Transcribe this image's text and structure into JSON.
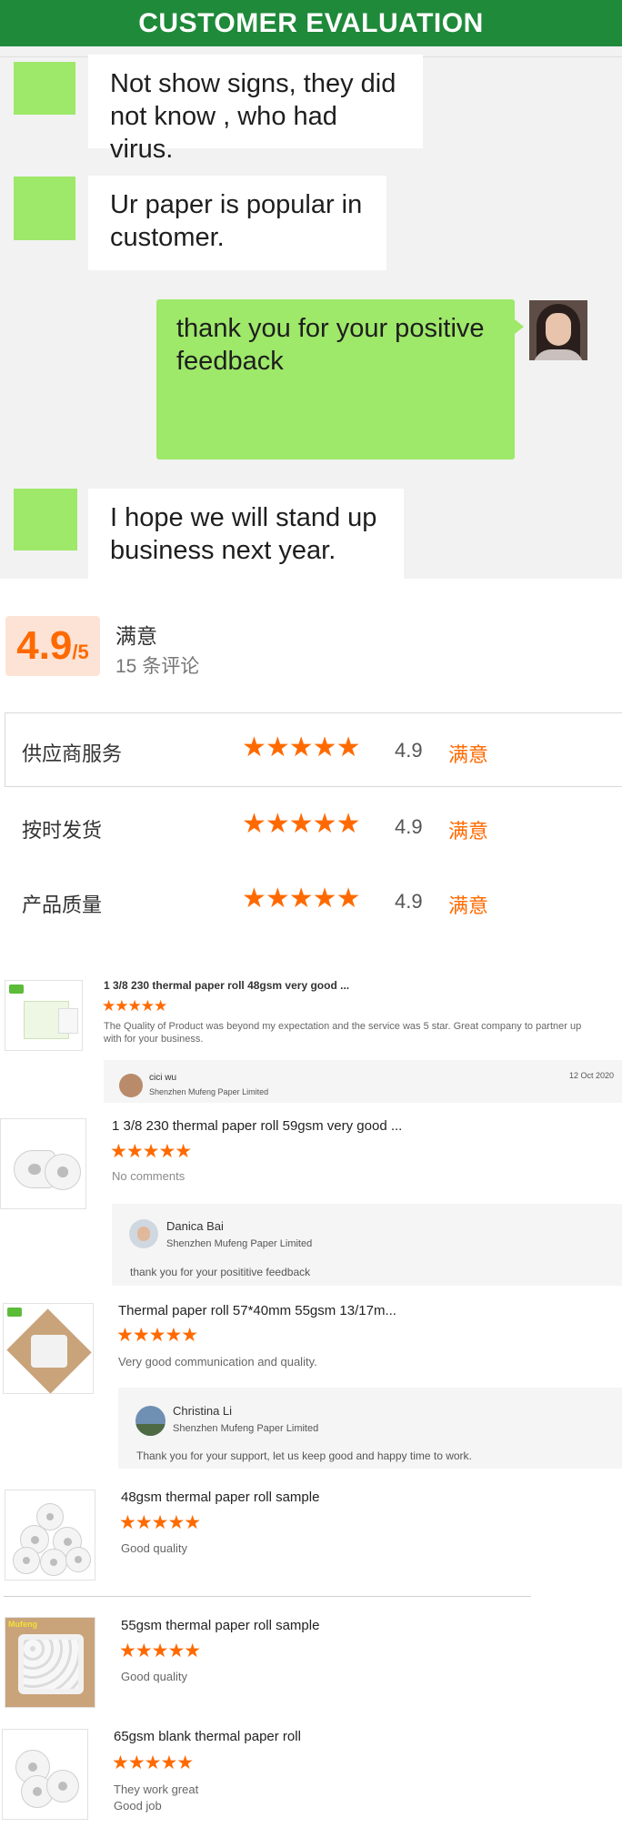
{
  "header": {
    "title": "CUSTOMER EVALUATION"
  },
  "chat": {
    "messages": [
      {
        "from": "customer",
        "text_lines": [
          "Not show signs, they did",
          "not know , who had virus."
        ]
      },
      {
        "from": "customer",
        "text_lines": [
          "Ur paper is popular in",
          "customer."
        ]
      },
      {
        "from": "seller",
        "text_lines": [
          "thank you for your positive",
          "feedback"
        ]
      },
      {
        "from": "customer",
        "text_lines": [
          "I hope we will stand up",
          "business next year."
        ]
      }
    ]
  },
  "rating_summary": {
    "score": "4.9",
    "score_suffix": "/5",
    "label": "满意",
    "count_text": "15 条评论",
    "stars_symbol": "★★★★★",
    "rows": [
      {
        "label": "供应商服务",
        "value": "4.9",
        "status": "满意",
        "stars": 5
      },
      {
        "label": "按时发货",
        "value": "4.9",
        "status": "满意",
        "stars": 5
      },
      {
        "label": "产品质量",
        "value": "4.9",
        "status": "满意",
        "stars": 5
      }
    ]
  },
  "reviews": [
    {
      "title": "1 3/8 230 thermal paper roll 48gsm very good ...",
      "stars": "★★★★★",
      "comment_lines": [
        "The Quality of Product was beyond my expectation and the service was 5 star. Great company to partner up",
        "with for your business."
      ],
      "reply": {
        "name": "cici wu",
        "company": "Shenzhen Mufeng Paper Limited",
        "date": "12 Oct 2020",
        "text": ""
      }
    },
    {
      "title": "1 3/8 230 thermal paper roll 59gsm very good ...",
      "stars": "★★★★★",
      "comment_lines": [
        "No comments"
      ],
      "reply": {
        "name": "Danica Bai",
        "company": "Shenzhen Mufeng Paper Limited",
        "date": "",
        "text": "thank you for your posititive feedback"
      }
    },
    {
      "title": "Thermal paper roll 57*40mm 55gsm 13/17m...",
      "stars": "★★★★★",
      "comment_lines": [
        "Very good communication and quality."
      ],
      "reply": {
        "name": "Christina Li",
        "company": "Shenzhen Mufeng Paper Limited",
        "date": "",
        "text": "Thank you for your support, let us keep good and happy time to work."
      }
    },
    {
      "title": "48gsm thermal paper roll sample",
      "stars": "★★★★★",
      "comment_lines": [
        "Good quality"
      ]
    },
    {
      "title": "55gsm thermal paper roll sample",
      "stars": "★★★★★",
      "comment_lines": [
        "Good quality"
      ],
      "thumb_text": "Mufeng"
    },
    {
      "title": "65gsm blank thermal paper roll",
      "stars": "★★★★★",
      "comment_lines": [
        "They work great",
        "Good job"
      ]
    }
  ],
  "colors": {
    "header_bg": "#1f8a3a",
    "bubble_green": "#9ee86a",
    "accent_orange": "#ff6a00"
  },
  "icons": {
    "star": "star-icon",
    "avatar": "avatar",
    "product": "product-thumbnail"
  }
}
